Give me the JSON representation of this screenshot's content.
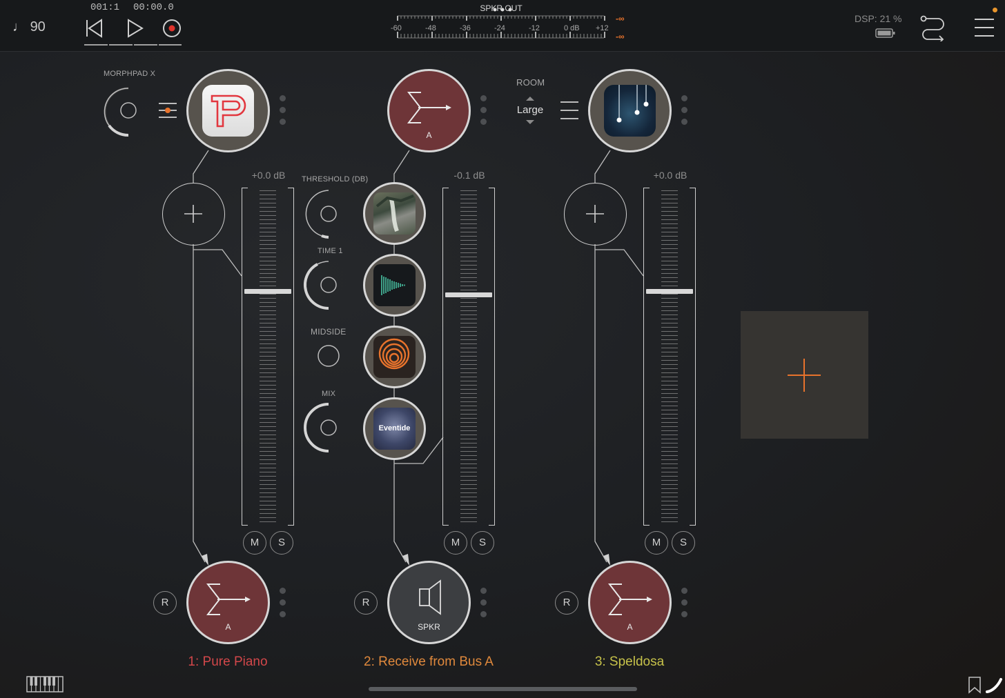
{
  "transport": {
    "tempo": "90",
    "position_bars": "001:1",
    "position_time": "00:00.0"
  },
  "meter": {
    "title": "SPKR OUT",
    "scale": [
      "-60",
      "-48",
      "-36",
      "-24",
      "-12",
      "0 dB",
      "+12"
    ],
    "peak_top": "-∞",
    "peak_bottom": "-∞"
  },
  "status": {
    "dsp": "DSP: 21 %"
  },
  "channels": [
    {
      "name": "1: Pure Piano",
      "name_color": "#d2474a",
      "param_label": "MORPHPAD X",
      "gain": "+0.0 dB",
      "fader_level": 0.7,
      "mute": "M",
      "solo": "S",
      "record": "R",
      "output_label": "A"
    },
    {
      "name": "2: Receive from Bus A",
      "name_color": "#e0893c",
      "input_label": "A",
      "gain": "-0.1 dB",
      "fader_level": 0.69,
      "mute": "M",
      "solo": "S",
      "record": "R",
      "output_label": "SPKR",
      "fx_params": [
        {
          "label": "THRESHOLD (DB)"
        },
        {
          "label": "TIME 1"
        },
        {
          "label": "MIDSIDE"
        },
        {
          "label": "MIX"
        }
      ],
      "fx_brand": "Eventide"
    },
    {
      "name": "3: Speldosa",
      "name_color": "#c7c24a",
      "param_label": "ROOM",
      "param_value": "Large",
      "gain": "+0.0 dB",
      "fader_level": 0.7,
      "mute": "M",
      "solo": "S",
      "record": "R",
      "output_label": "A"
    }
  ],
  "colors": {
    "accent": "#e8732c",
    "bus_node": "#6e3538",
    "plugin_node": "#57534d"
  }
}
